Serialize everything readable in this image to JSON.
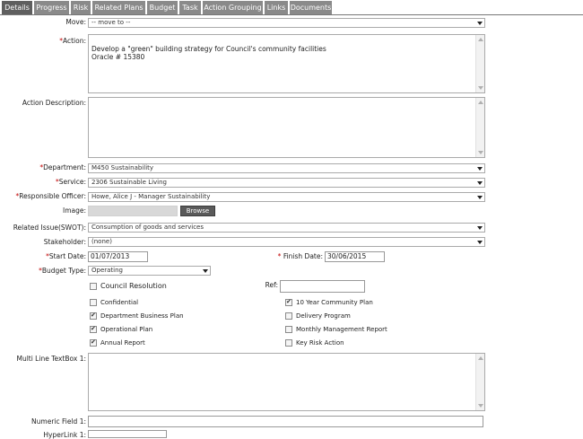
{
  "tabs": [
    "Details",
    "Progress",
    "Risk",
    "Related Plans",
    "Budget",
    "Task",
    "Action Grouping",
    "Links",
    "Documents"
  ],
  "labels": {
    "move": "Move:",
    "action": "Action:",
    "action_description": "Action Description:",
    "department": "Department:",
    "service": "Service:",
    "responsible_officer": "Responsible Officer:",
    "image": "Image:",
    "related_issue": "Related Issue(SWOT):",
    "stakeholder": "Stakeholder:",
    "start_date": "Start Date:",
    "finish_date": "Finish Date:",
    "budget_type": "Budget Type:",
    "ref": "Ref:",
    "multi_line": "Multi Line TextBox 1:",
    "numeric": "Numeric Field 1:",
    "hyperlink": "HyperLink 1:"
  },
  "required_mark": "*",
  "values": {
    "move": "-- move to --",
    "action": "Develop a \"green\" building strategy for Council's community facilities\nOracle # 15380",
    "action_description": "",
    "department": "M450 Sustainability",
    "service": "2306 Sustainable Living",
    "responsible_officer": "Howe, Alice J - Manager Sustainability",
    "related_issue": "Consumption of goods and services",
    "stakeholder": "(none)",
    "start_date": "01/07/2013",
    "finish_date": "30/06/2015",
    "budget_type": "Operating",
    "ref": "",
    "multi_line": "",
    "numeric": "",
    "hyperlink": ""
  },
  "browse_label": "Browse",
  "council_resolution": {
    "label": "Council Resolution",
    "checked": false
  },
  "checkboxes_left": [
    {
      "label": "Confidential",
      "checked": false
    },
    {
      "label": "Department Business Plan",
      "checked": true
    },
    {
      "label": "Operational Plan",
      "checked": true
    },
    {
      "label": "Annual Report",
      "checked": true
    }
  ],
  "checkboxes_right": [
    {
      "label": "10 Year Community Plan",
      "checked": true
    },
    {
      "label": "Delivery Program",
      "checked": false
    },
    {
      "label": "Monthly Management Report",
      "checked": false
    },
    {
      "label": "Key Risk Action",
      "checked": false
    }
  ]
}
